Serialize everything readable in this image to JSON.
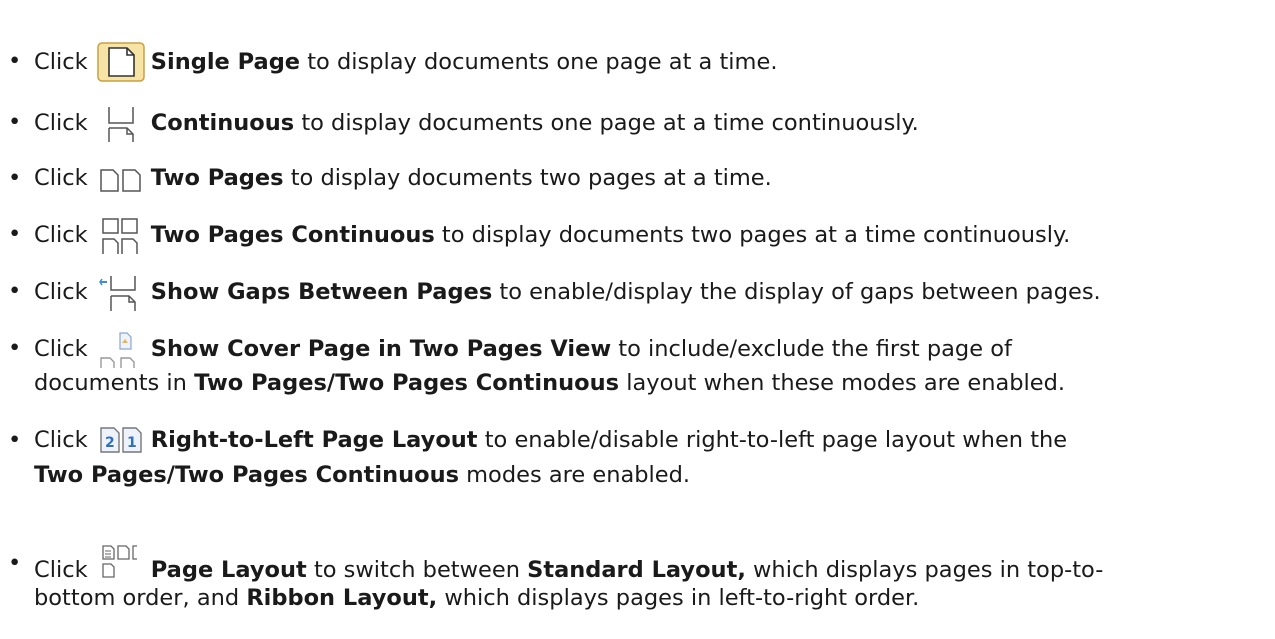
{
  "items": [
    {
      "click": "Click",
      "icon": "single-page-icon",
      "label": "Single Page",
      "desc": "to display documents one page at a time."
    },
    {
      "click": "Click",
      "icon": "continuous-icon",
      "label": "Continuous",
      "desc": "to display documents one page at a time continuously."
    },
    {
      "click": "Click",
      "icon": "two-pages-icon",
      "label": "Two Pages",
      "desc": "to display documents two pages at a time."
    },
    {
      "click": "Click",
      "icon": "two-pages-continuous-icon",
      "label": "Two Pages Continuous",
      "desc": "to display documents two pages at a time continuously."
    },
    {
      "click": "Click",
      "icon": "show-gaps-icon",
      "label": "Show Gaps Between Pages",
      "desc": "to enable/display the display of gaps between pages."
    },
    {
      "click": "Click",
      "icon": "cover-page-icon",
      "label": "Show Cover Page in Two Pages View",
      "desc": "to include/exclude the first page of",
      "line2_a": "documents in",
      "line2_bold": "Two Pages/Two Pages Continuous",
      "line2_b": "layout when these modes are enabled."
    },
    {
      "click": "Click",
      "icon": "right-to-left-icon",
      "label": "Right-to-Left Page Layout",
      "desc": "to enable/disable right-to-left page layout when the",
      "line2_bold": "Two Pages/Two Pages Continuous",
      "line2_b": "modes are enabled."
    },
    {
      "click": "Click",
      "icon": "page-layout-icon",
      "label": "Page Layout",
      "desc": "to switch between",
      "desc_bold": "Standard Layout,",
      "desc_tail": "which displays pages in top-to-",
      "line2_a": "bottom order, and",
      "line2_bold": "Ribbon Layout,",
      "line2_b": "which displays pages in left-to-right order."
    }
  ]
}
